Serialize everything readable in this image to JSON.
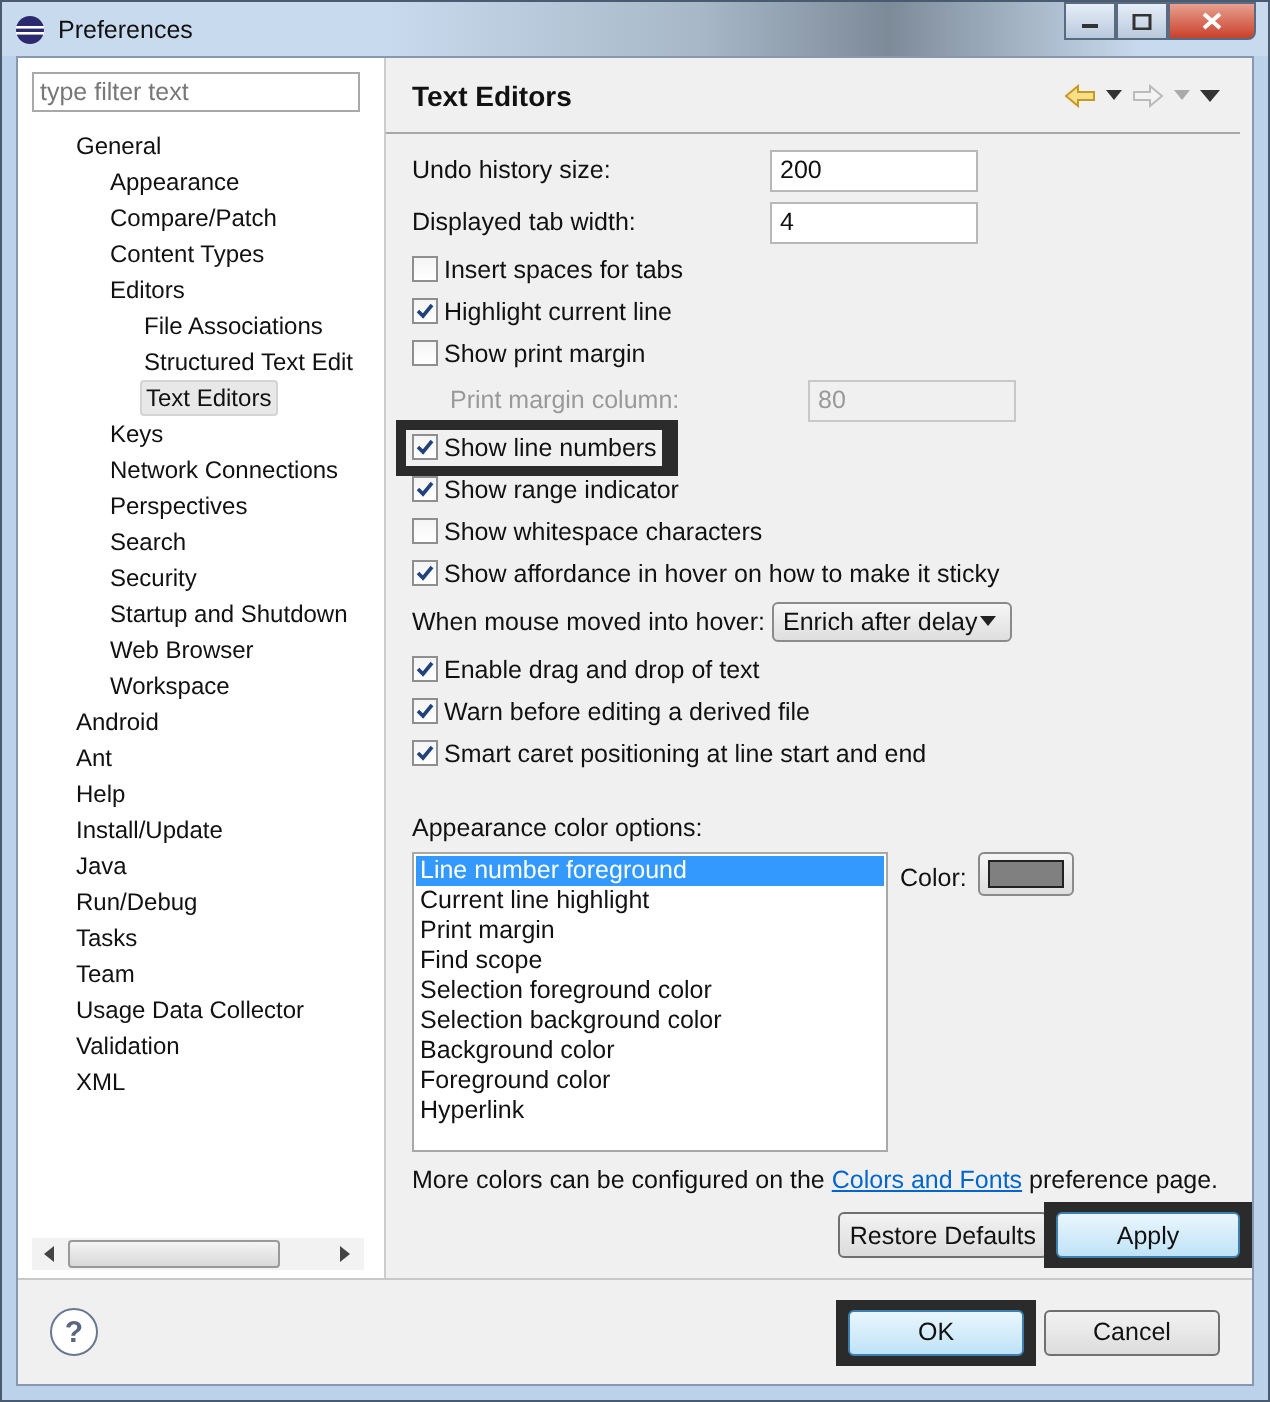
{
  "window": {
    "title": "Preferences"
  },
  "filter": {
    "placeholder": "type filter text"
  },
  "tree": [
    {
      "label": "General",
      "selected": false,
      "children": [
        {
          "label": "Appearance",
          "selected": false
        },
        {
          "label": "Compare/Patch",
          "selected": false
        },
        {
          "label": "Content Types",
          "selected": false
        },
        {
          "label": "Editors",
          "selected": false,
          "children": [
            {
              "label": "File Associations",
              "selected": false
            },
            {
              "label": "Structured Text Edit",
              "selected": false
            },
            {
              "label": "Text Editors",
              "selected": true
            }
          ]
        },
        {
          "label": "Keys",
          "selected": false
        },
        {
          "label": "Network Connections",
          "selected": false
        },
        {
          "label": "Perspectives",
          "selected": false
        },
        {
          "label": "Search",
          "selected": false
        },
        {
          "label": "Security",
          "selected": false
        },
        {
          "label": "Startup and Shutdown",
          "selected": false
        },
        {
          "label": "Web Browser",
          "selected": false
        },
        {
          "label": "Workspace",
          "selected": false
        }
      ]
    },
    {
      "label": "Android",
      "selected": false
    },
    {
      "label": "Ant",
      "selected": false
    },
    {
      "label": "Help",
      "selected": false
    },
    {
      "label": "Install/Update",
      "selected": false
    },
    {
      "label": "Java",
      "selected": false
    },
    {
      "label": "Run/Debug",
      "selected": false
    },
    {
      "label": "Tasks",
      "selected": false
    },
    {
      "label": "Team",
      "selected": false
    },
    {
      "label": "Usage Data Collector",
      "selected": false
    },
    {
      "label": "Validation",
      "selected": false
    },
    {
      "label": "XML",
      "selected": false
    }
  ],
  "page": {
    "title": "Text Editors"
  },
  "settings": [
    {
      "kind": "field",
      "label": "Undo history size:",
      "value": "200",
      "disabled": false
    },
    {
      "kind": "field",
      "label": "Displayed tab width:",
      "value": "4",
      "disabled": false
    },
    {
      "kind": "checkbox",
      "label": "Insert spaces for tabs",
      "checked": false,
      "highlighted": false
    },
    {
      "kind": "checkbox",
      "label": "Highlight current line",
      "checked": true,
      "highlighted": false
    },
    {
      "kind": "checkbox",
      "label": "Show print margin",
      "checked": false,
      "highlighted": false
    },
    {
      "kind": "field",
      "label": "Print margin column:",
      "value": "80",
      "disabled": true
    },
    {
      "kind": "checkbox",
      "label": "Show line numbers",
      "checked": true,
      "highlighted": true
    },
    {
      "kind": "checkbox",
      "label": "Show range indicator",
      "checked": true,
      "highlighted": false
    },
    {
      "kind": "checkbox",
      "label": "Show whitespace characters",
      "checked": false,
      "highlighted": false
    },
    {
      "kind": "checkbox",
      "label": "Show affordance in hover on how to make it sticky",
      "checked": true,
      "highlighted": false
    },
    {
      "kind": "dropdown",
      "label": "When mouse moved into hover:",
      "value": "Enrich after delay"
    },
    {
      "kind": "checkbox",
      "label": "Enable drag and drop of text",
      "checked": true,
      "highlighted": false
    },
    {
      "kind": "checkbox",
      "label": "Warn before editing a derived file",
      "checked": true,
      "highlighted": false
    },
    {
      "kind": "checkbox",
      "label": "Smart caret positioning at line start and end",
      "checked": true,
      "highlighted": false
    }
  ],
  "color_options": {
    "label": "Appearance color options:",
    "color_label": "Color:",
    "items": [
      {
        "label": "Line number foreground",
        "selected": true
      },
      {
        "label": "Current line highlight",
        "selected": false
      },
      {
        "label": "Print margin",
        "selected": false
      },
      {
        "label": "Find scope",
        "selected": false
      },
      {
        "label": "Selection foreground color",
        "selected": false
      },
      {
        "label": "Selection background color",
        "selected": false
      },
      {
        "label": "Background color",
        "selected": false
      },
      {
        "label": "Foreground color",
        "selected": false
      },
      {
        "label": "Hyperlink",
        "selected": false
      }
    ]
  },
  "note": {
    "before": "More colors can be configured on the ",
    "link": "Colors and Fonts",
    "after": " preference page."
  },
  "page_buttons": [
    {
      "label": "Restore Defaults",
      "focused": false,
      "highlighted": false
    },
    {
      "label": "Apply",
      "focused": true,
      "highlighted": true
    }
  ],
  "help": {
    "glyph": "?"
  },
  "dialog_buttons": [
    {
      "label": "OK",
      "focused": true,
      "highlighted": true
    },
    {
      "label": "Cancel",
      "focused": false,
      "highlighted": false
    }
  ]
}
